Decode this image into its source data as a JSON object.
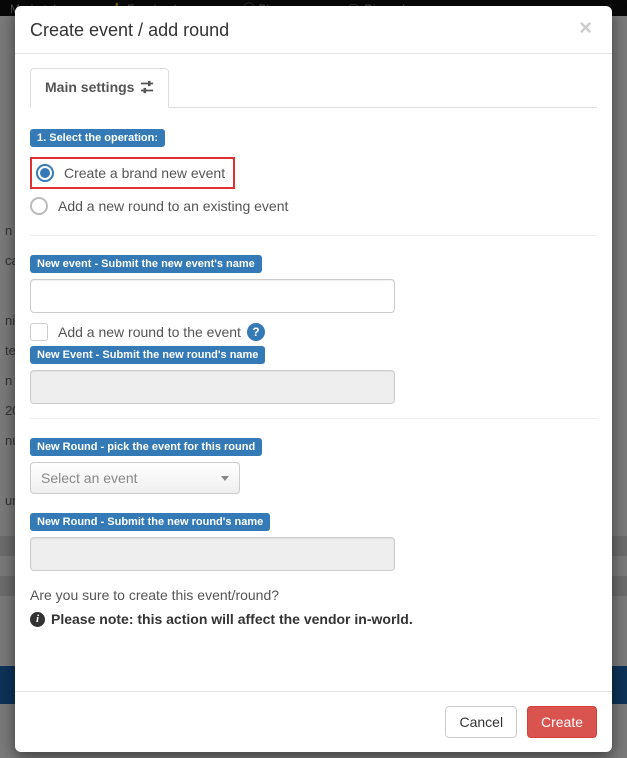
{
  "bg_topbar": {
    "marketplace": "Marketplace",
    "facebook": "Facebook",
    "blog": "Blog",
    "discord": "Discord"
  },
  "modal": {
    "title": "Create event / add round",
    "tab_main": "Main settings",
    "step1_label": "1. Select the operation:",
    "opt_new_event": "Create a brand new event",
    "opt_add_round": "Add a new round to an existing event",
    "section_new_event_name": "New event - Submit the new event's name",
    "check_add_round": "Add a new round to the event",
    "section_new_event_round_name": "New Event - Submit the new round's name",
    "section_pick_event": "New Round - pick the event for this round",
    "select_placeholder": "Select an event",
    "section_new_round_name": "New Round - Submit the new round's name",
    "confirm_text": "Are you sure to create this event/round?",
    "note_text": "Please note: this action will affect the vendor in-world.",
    "cancel": "Cancel",
    "create": "Create"
  }
}
